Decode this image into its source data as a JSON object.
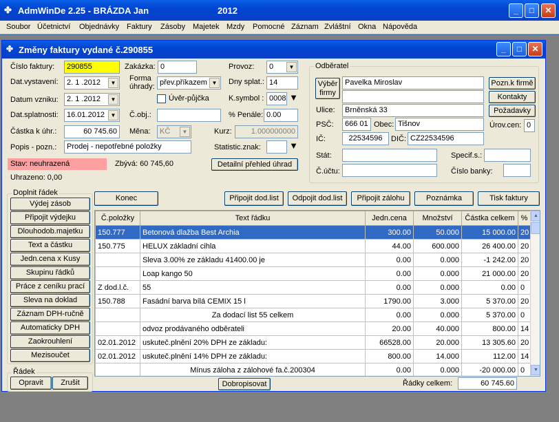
{
  "app": {
    "title": "AdmWinDe 2.25 - BRÁZDA Jan",
    "year": "2012"
  },
  "menu": [
    "Soubor",
    "Účetnictví",
    "Objednávky",
    "Faktury",
    "Zásoby",
    "Majetek",
    "Mzdy",
    "Pomocné",
    "Záznam",
    "Zvláštní",
    "Okna",
    "Nápověda"
  ],
  "window": {
    "title": "Změny faktury vydané č.290855"
  },
  "form": {
    "cislo_faktury_label": "Číslo faktury:",
    "cislo_faktury": "290855",
    "zakazka_label": "Zakázka:",
    "zakazka": "0",
    "provoz_label": "Provoz:",
    "provoz": "0",
    "dat_vystaveni_label": "Dat.vystavení:",
    "dat_vystaveni": "2. 1 .2012",
    "forma_uhrady_label": "Forma úhrady:",
    "forma_uhrady": "přev.příkazem",
    "dny_splat_label": "Dny splat.:",
    "dny_splat": "14",
    "datum_vzniku_label": "Datum vzniku:",
    "datum_vzniku": "2. 1 .2012",
    "uver_pujcka_label": "Úvěr-půjčka",
    "ksymbol_label": "K.symbol :",
    "ksymbol": "0008",
    "dat_splatnosti_label": "Dat.splatnosti:",
    "dat_splatnosti": "16.01.2012",
    "cobj_label": "Č.obj.:",
    "cobj": "",
    "penale_label": "% Penále:",
    "penale": "0.00",
    "castka_label": "Částka k úhr.:",
    "castka": "60 745.60",
    "mena_label": "Měna:",
    "mena": "KČ",
    "kurz_label": "Kurz:",
    "kurz": "1.000000000",
    "popis_label": "Popis - pozn.:",
    "popis": "Prodej - nepotřebné položky",
    "stat_znak_label": "Statistic.znak:",
    "stat_znak": ""
  },
  "status": {
    "stav": "Stav: neuhrazená",
    "zbyva": "Zbývá: 60 745,60",
    "detail_button": "Detailní přehled úhrad",
    "uhrazeno": "Uhrazeno: 0,00"
  },
  "odberatel": {
    "group_title": "Odběratel",
    "vyber_button": "Výběr firmy",
    "name": "Pavelka Miroslav",
    "name2": "",
    "ulice_label": "Ulice:",
    "ulice": "Brněnská 33",
    "psc_label": "PSČ:",
    "psc": "666 01",
    "obec_label": "Obec:",
    "obec": "Tišnov",
    "ic_label": "IČ:",
    "ic": "22534596",
    "dic_label": "DIČ:",
    "dic": "CZ22534596",
    "stat_label": "Stát:",
    "stat": "",
    "specif_label": "Specif.s.:",
    "specif": "",
    "cucet_label": "Č.účtu:",
    "cucet": "",
    "banka_label": "Číslo banky:",
    "banka": "",
    "pozn_button": "Pozn.k firmě",
    "kontakty_button": "Kontakty",
    "pozadavky_button": "Požadavky",
    "uroven_label": "Úrov.cen:",
    "uroven": "0"
  },
  "doplnit": {
    "title": "Doplnit řádek",
    "buttons": [
      "Výdej zásob",
      "Připojit výdejku",
      "Dlouhodob.majetku",
      "Text a částku",
      "Jedn.cena x Kusy",
      "Skupinu řádků",
      "Práce z ceníku prací",
      "Sleva na doklad",
      "Záznam DPH-ručně",
      "Automaticky DPH",
      "Zaokrouhlení",
      "Mezisoučet"
    ]
  },
  "radek": {
    "title": "Řádek",
    "opravit": "Opravit",
    "zrusit": "Zrušit"
  },
  "toolbar": {
    "konec": "Konec",
    "pripojit_dl": "Připojit dod.list",
    "odpojit_dl": "Odpojit dod.list",
    "pripojit_zal": "Připojit zálohu",
    "poznamka": "Poznámka",
    "tisk": "Tisk faktury"
  },
  "grid": {
    "headers": [
      "Č.položky",
      "Text řádku",
      "Jedn.cena",
      "Množství",
      "Částka celkem",
      "%"
    ],
    "rows": [
      [
        "150.777",
        "Betonová dlažba Best Archia",
        "300.00",
        "50.000",
        "15 000.00",
        "20"
      ],
      [
        "150.775",
        "HELUX základní cihla",
        "44.00",
        "600.000",
        "26 400.00",
        "20"
      ],
      [
        "",
        "Sleva   3.00% ze základu   41400.00 je",
        "0.00",
        "0.000",
        "-1 242.00",
        "20"
      ],
      [
        "",
        "Loap kango 50",
        "0.00",
        "0.000",
        "21 000.00",
        "20"
      ],
      [
        "Z dod.l.č.",
        "55",
        "0.00",
        "0.000",
        "0.00",
        "0"
      ],
      [
        "150.788",
        "Fasádní barva bílá CEMIX 15 l",
        "1790.00",
        "3.000",
        "5 370.00",
        "20"
      ],
      [
        "",
        "Za dodací list 55 celkem",
        "0.00",
        "0.000",
        "5 370.00",
        "0"
      ],
      [
        "",
        "odvoz prodávaného odběrateli",
        "20.00",
        "40.000",
        "800.00",
        "14"
      ],
      [
        "02.01.2012",
        "uskuteč.plnění  20% DPH ze základu:",
        "66528.00",
        "20.000",
        "13 305.60",
        "20"
      ],
      [
        "02.01.2012",
        "uskuteč.plnění  14% DPH ze základu:",
        "800.00",
        "14.000",
        "112.00",
        "14"
      ],
      [
        "",
        "Mínus záloha z zálohové fa.č.200304",
        "0.00",
        "0.000",
        "-20 000.00",
        "0"
      ]
    ]
  },
  "footer": {
    "dobropisovat": "Dobropisovat",
    "radky_label": "Řádky celkem:",
    "radky": "60 745.60"
  }
}
